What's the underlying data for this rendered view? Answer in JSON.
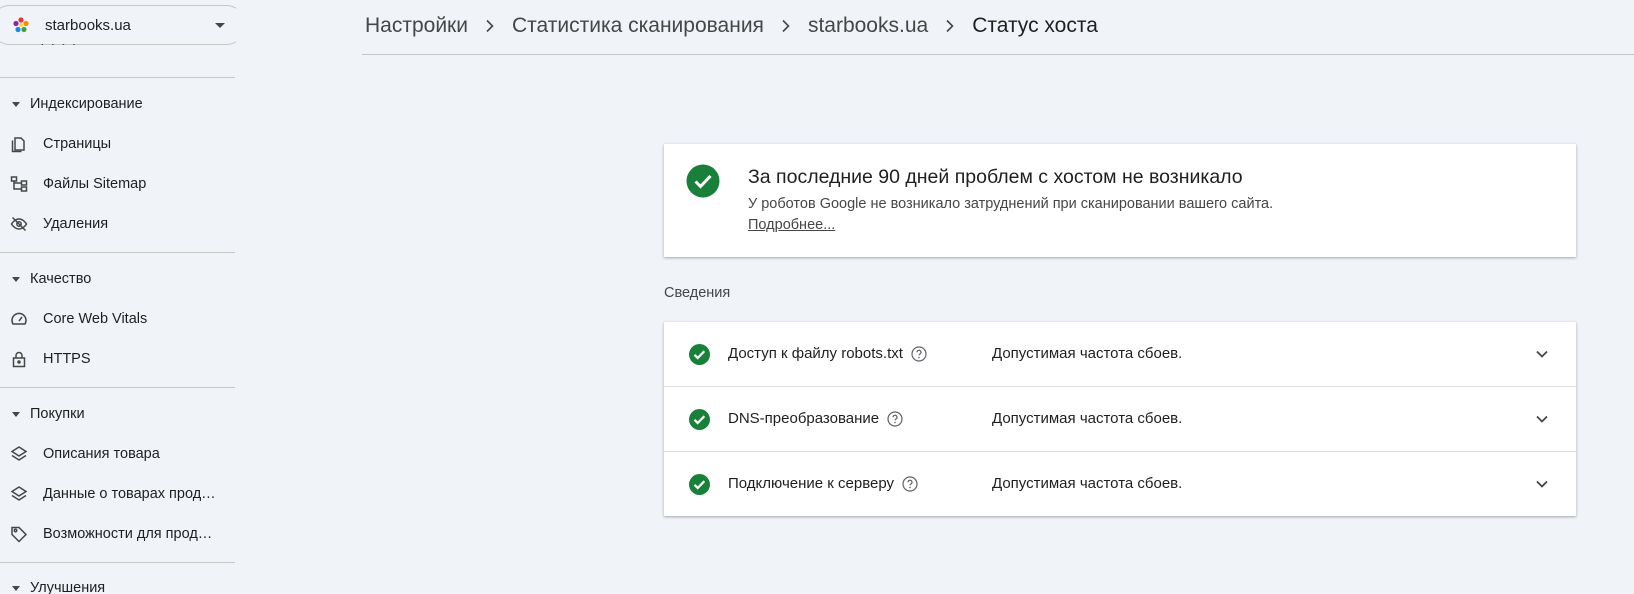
{
  "property": {
    "name": "starbooks.ua"
  },
  "sidebar": {
    "cut_item": "· · · ·",
    "sections": [
      {
        "label": "Индексирование",
        "items": [
          {
            "label": "Страницы",
            "icon": "pages-icon"
          },
          {
            "label": "Файлы Sitemap",
            "icon": "sitemap-icon"
          },
          {
            "label": "Удаления",
            "icon": "removals-icon"
          }
        ]
      },
      {
        "label": "Качество",
        "items": [
          {
            "label": "Core Web Vitals",
            "icon": "speedometer-icon"
          },
          {
            "label": "HTTPS",
            "icon": "lock-icon"
          }
        ]
      },
      {
        "label": "Покупки",
        "items": [
          {
            "label": "Описания товара",
            "icon": "layers-icon"
          },
          {
            "label": "Данные о товарах прод…",
            "icon": "layers-icon"
          },
          {
            "label": "Возможности для прод…",
            "icon": "tag-icon"
          }
        ]
      },
      {
        "label": "Улучшения",
        "items": []
      }
    ]
  },
  "breadcrumb": {
    "items": [
      "Настройки",
      "Статистика сканирования",
      "starbooks.ua"
    ],
    "current": "Статус хоста"
  },
  "status": {
    "title": "За последние 90 дней проблем с хостом не возникало",
    "description": "У роботов Google не возникало затруднений при сканировании вашего сайта.",
    "more_link": "Подробнее..."
  },
  "details": {
    "label": "Сведения",
    "rows": [
      {
        "name": "Доступ к файлу robots.txt",
        "value": "Допустимая частота сбоев."
      },
      {
        "name": "DNS-преобразование",
        "value": "Допустимая частота сбоев."
      },
      {
        "name": "Подключение к серверу",
        "value": "Допустимая частота сбоев."
      }
    ]
  },
  "colors": {
    "success": "#188038",
    "text": "#1f1f1f",
    "muted": "#444746",
    "background": "#f0f4f9"
  }
}
